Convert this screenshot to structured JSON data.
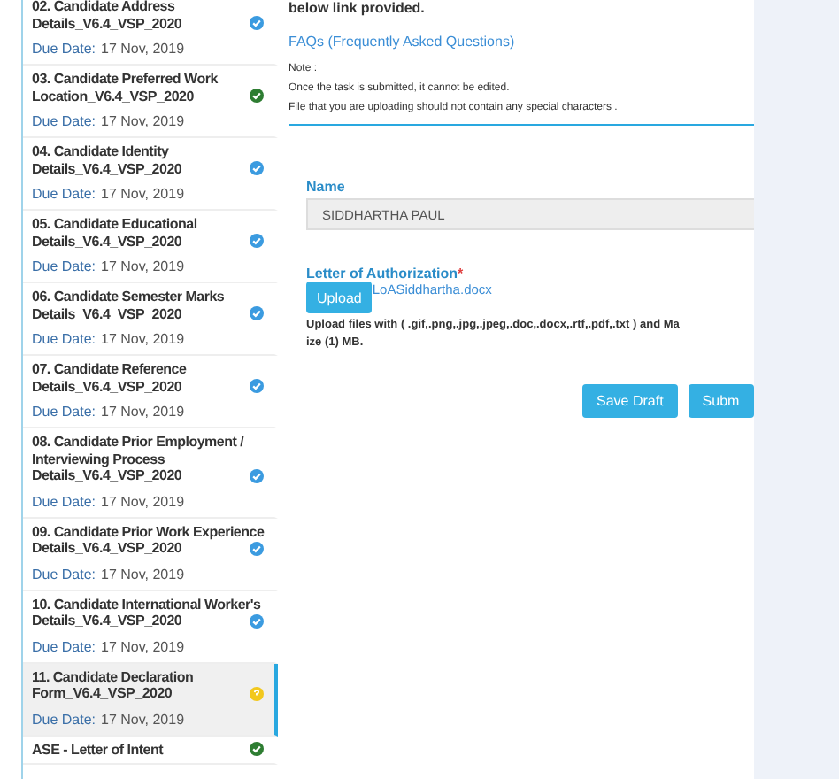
{
  "sidebar": {
    "items": [
      {
        "title": "02. Candidate Address Details_V6.4_VSP_2020",
        "due_label": "Due Date:",
        "due_date": "17 Nov, 2019",
        "kind": "check",
        "color": "#3b9be0",
        "selected": false
      },
      {
        "title": "03. Candidate Preferred Work Location_V6.4_VSP_2020",
        "due_label": "Due Date:",
        "due_date": "17 Nov, 2019",
        "kind": "check",
        "color": "#2e7d32",
        "selected": false
      },
      {
        "title": "04. Candidate Identity Details_V6.4_VSP_2020",
        "due_label": "Due Date:",
        "due_date": "17 Nov, 2019",
        "kind": "check",
        "color": "#3b9be0",
        "selected": false
      },
      {
        "title": "05. Candidate Educational Details_V6.4_VSP_2020",
        "due_label": "Due Date:",
        "due_date": "17 Nov, 2019",
        "kind": "check",
        "color": "#3b9be0",
        "selected": false
      },
      {
        "title": "06. Candidate Semester Marks Details_V6.4_VSP_2020",
        "due_label": "Due Date:",
        "due_date": "17 Nov, 2019",
        "kind": "check",
        "color": "#3b9be0",
        "selected": false
      },
      {
        "title": "07. Candidate Reference Details_V6.4_VSP_2020",
        "due_label": "Due Date:",
        "due_date": "17 Nov, 2019",
        "kind": "check",
        "color": "#3b9be0",
        "selected": false
      },
      {
        "title": "08. Candidate Prior Employment / Interviewing Process Details_V6.4_VSP_2020",
        "due_label": "Due Date:",
        "due_date": "17 Nov, 2019",
        "kind": "check",
        "color": "#3b9be0",
        "selected": false
      },
      {
        "title": "09. Candidate Prior Work Experience Details_V6.4_VSP_2020",
        "due_label": "Due Date:",
        "due_date": "17 Nov, 2019",
        "kind": "check",
        "color": "#3b9be0",
        "selected": false
      },
      {
        "title": "10. Candidate International Worker's Details_V6.4_VSP_2020",
        "due_label": "Due Date:",
        "due_date": "17 Nov, 2019",
        "kind": "check",
        "color": "#3b9be0",
        "selected": false
      },
      {
        "title": "11. Candidate Declaration Form_V6.4_VSP_2020",
        "due_label": "Due Date:",
        "due_date": "17 Nov, 2019",
        "kind": "question",
        "color": "#f2c81e",
        "selected": true
      },
      {
        "title": "ASE - Letter of Intent",
        "kind": "check",
        "color": "#2e7d32",
        "selected": false
      }
    ]
  },
  "info": {
    "intro": "below link provided.",
    "faq_link": "FAQs (Frequently Asked Questions)",
    "note_label": "Note :",
    "notes": [
      "Once the task is submitted, it cannot be edited.",
      "File that you are uploading should not contain any special characters ."
    ]
  },
  "form": {
    "name_label": "Name",
    "name_value": "SIDDHARTHA PAUL",
    "file_label": "Letter of Authorization",
    "required_mark": "*",
    "upload_button": "Upload",
    "file_name": "LoASiddhartha.docx",
    "help_lines": [
      "Upload files with ( .gif,.png,.jpg,.jpeg,.doc,.docx,.rtf,.pdf,.txt ) and Ma",
      "ize (1) MB."
    ],
    "buttons": [
      "Save Draft",
      "Subm"
    ]
  }
}
